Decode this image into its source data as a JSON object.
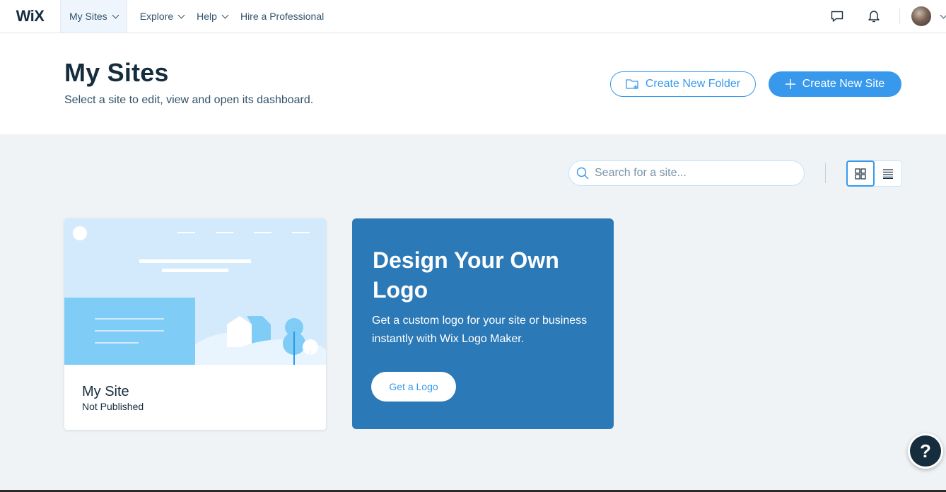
{
  "topbar": {
    "logo": "WiX",
    "nav": [
      {
        "label": "My Sites",
        "has_dropdown": true,
        "active": true
      },
      {
        "label": "Explore",
        "has_dropdown": true
      },
      {
        "label": "Help",
        "has_dropdown": true
      },
      {
        "label": "Hire a Professional",
        "has_dropdown": false
      }
    ],
    "icons": [
      "chat-icon",
      "bell-icon",
      "avatar"
    ]
  },
  "header": {
    "title": "My Sites",
    "subtitle": "Select a site to edit, view and open its dashboard.",
    "create_folder_label": "Create New Folder",
    "create_site_label": "Create New Site"
  },
  "toolbar": {
    "search_placeholder": "Search for a site...",
    "view_mode": "grid"
  },
  "sites": [
    {
      "name": "My Site",
      "status": "Not Published"
    }
  ],
  "promo": {
    "title": "Design Your Own Logo",
    "text": "Get a custom logo for your site or business instantly with Wix Logo Maker.",
    "button_label": "Get a Logo"
  },
  "help": {
    "label": "?"
  },
  "colors": {
    "accent": "#3899ec",
    "text_dark": "#162d3d",
    "promo_bg": "#2b79b7",
    "page_bg": "#eff3f6"
  }
}
